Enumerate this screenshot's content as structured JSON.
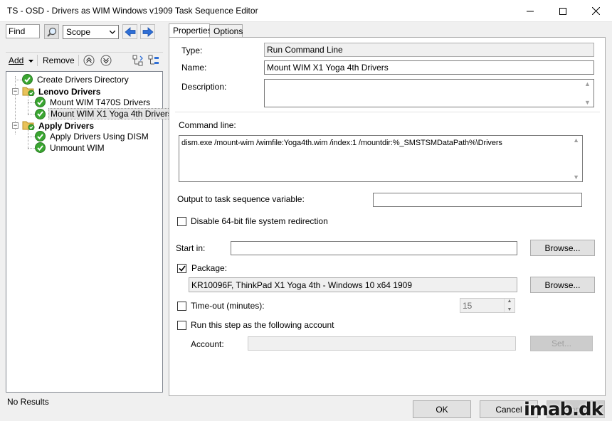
{
  "window": {
    "title": "TS - OSD - Drivers as WIM Windows v1909 Task Sequence Editor"
  },
  "toolbar": {
    "find_value": "Find",
    "scope_value": "Scope",
    "add_label": "Add",
    "remove_label": "Remove"
  },
  "tree": {
    "items": [
      {
        "label": "Create Drivers Directory"
      },
      {
        "label": "Lenovo Drivers"
      },
      {
        "label": "Mount WIM T470S Drivers"
      },
      {
        "label": "Mount WIM X1 Yoga 4th Drivers"
      },
      {
        "label": "Apply Drivers"
      },
      {
        "label": "Apply Drivers Using DISM"
      },
      {
        "label": "Unmount WIM"
      }
    ]
  },
  "status": "No Results",
  "tabs": {
    "properties": "Properties",
    "options": "Options"
  },
  "form": {
    "type_label": "Type:",
    "type_value": "Run Command Line",
    "name_label": "Name:",
    "name_value": "Mount WIM X1 Yoga 4th Drivers",
    "description_label": "Description:",
    "description_value": "",
    "command_line_label": "Command line:",
    "command_line_value": "dism.exe /mount-wim /wimfile:Yoga4th.wim /index:1 /mountdir:%_SMSTSMDataPath%\\Drivers",
    "output_var_label": "Output to task sequence variable:",
    "output_var_value": "",
    "disable_64bit_label": "Disable 64-bit file system redirection",
    "start_in_label": "Start in:",
    "start_in_value": "",
    "browse_label": "Browse...",
    "package_label": "Package:",
    "package_value": "KR10096F, ThinkPad X1 Yoga 4th - Windows 10 x64 1909",
    "timeout_label": "Time-out (minutes):",
    "timeout_value": "15",
    "run_as_label": "Run this step as the following account",
    "account_label": "Account:",
    "account_value": "",
    "set_label": "Set..."
  },
  "footer": {
    "ok_label": "OK",
    "cancel_label": "Cancel",
    "apply_label": "Apply"
  },
  "watermark": "imab.dk",
  "colors": {
    "check_green": "#3aa631",
    "arrow_blue": "#2f6fd6",
    "folder_yellow": "#e8c25a"
  },
  "icons": {
    "search": "magnifier-icon",
    "up": "arrow-left-icon",
    "down": "arrow-right-icon",
    "check": "green-check-icon",
    "folder": "folder-icon"
  },
  "checkboxes": {
    "disable_64bit": false,
    "package": true,
    "timeout": false,
    "run_as": false
  }
}
